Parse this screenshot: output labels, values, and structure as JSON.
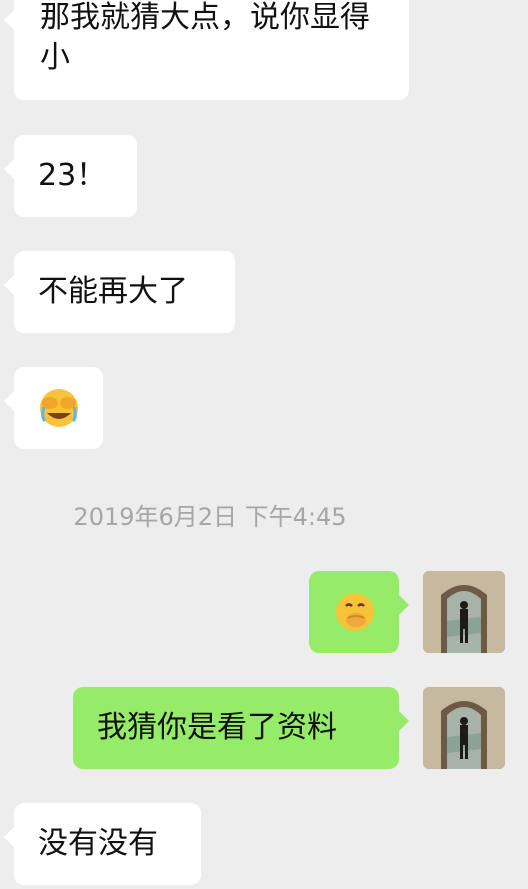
{
  "messages": [
    {
      "text": "那我就猜大点，说你显得小",
      "side": "left"
    },
    {
      "text": "23！",
      "side": "left"
    },
    {
      "text": "不能再大了",
      "side": "left"
    },
    {
      "emoji": "face-with-tears-of-joy-covering-eyes",
      "side": "left"
    },
    {
      "emoji": "face-with-hand-over-mouth",
      "side": "right"
    },
    {
      "text": "我猜你是看了资料",
      "side": "right"
    },
    {
      "text": "没有没有",
      "side": "left"
    }
  ],
  "timestamp": "2019年6月2日 下午4:45",
  "colors": {
    "background": "#ededed",
    "incoming_bubble": "#ffffff",
    "outgoing_bubble": "#95ec69",
    "timestamp_text": "#a6a6a6"
  },
  "avatar": {
    "icon": "user-avatar-photo"
  }
}
